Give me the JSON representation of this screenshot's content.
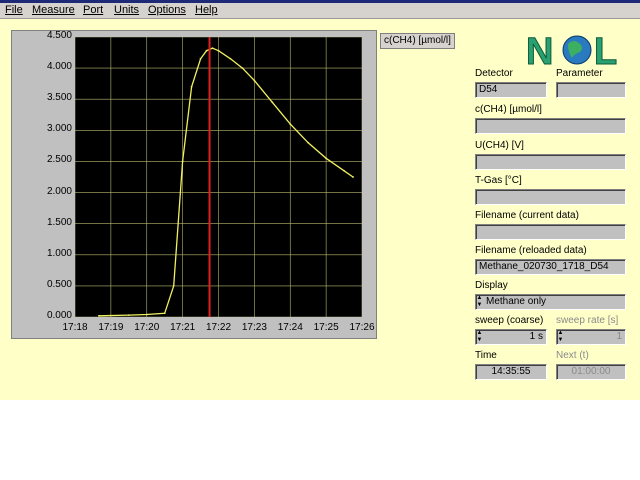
{
  "menu": {
    "items": [
      "File",
      "Measure",
      "Port",
      "Units",
      "Options",
      "Help"
    ]
  },
  "plot": {
    "label": "c(CH4) [µmol/l]",
    "y_ticks": [
      "4.500",
      "4.000",
      "3.500",
      "3.000",
      "2.500",
      "2.000",
      "1.500",
      "1.000",
      "0.500",
      "0.000"
    ],
    "x_ticks": [
      "17:18",
      "17:19",
      "17:20",
      "17:21",
      "17:22",
      "17:23",
      "17:24",
      "17:25",
      "17:26"
    ],
    "marker_time": "17:21:45",
    "colors": {
      "trace": "#f0f060",
      "marker": "#e02020",
      "grid": "#b8b870",
      "background": "#000000"
    }
  },
  "chart_data": {
    "type": "line",
    "title": "",
    "xlabel": "",
    "ylabel": "c(CH4) [µmol/l]",
    "xlim": [
      "17:18",
      "17:26"
    ],
    "ylim": [
      0,
      4.5
    ],
    "grid": true,
    "series": [
      {
        "x": [
          "17:18:40",
          "17:19:30",
          "17:20:00",
          "17:20:30",
          "17:20:45",
          "17:21:00",
          "17:21:15",
          "17:21:30",
          "17:21:40",
          "17:21:50",
          "17:22:00",
          "17:22:20",
          "17:22:40",
          "17:23:00",
          "17:23:30",
          "17:24:00",
          "17:24:30",
          "17:25:00",
          "17:25:30",
          "17:25:45"
        ],
        "y": [
          0.02,
          0.03,
          0.04,
          0.06,
          0.5,
          2.5,
          3.7,
          4.15,
          4.28,
          4.32,
          4.28,
          4.15,
          4.0,
          3.8,
          3.45,
          3.1,
          2.8,
          2.55,
          2.35,
          2.25
        ]
      }
    ]
  },
  "logo": {
    "text": "NOL"
  },
  "side": {
    "detector_label": "Detector",
    "detector_value": "D54",
    "parameter_label": "Parameter",
    "ch4_label": "c(CH4) [µmol/l]",
    "u_label": "U(CH4) [V]",
    "tgas_label": "T-Gas [°C]",
    "filename_current_label": "Filename (current data)",
    "filename_reloaded_label": "Filename (reloaded data)",
    "filename_reloaded_value": "Methane_020730_1718_D54",
    "display_label": "Display",
    "display_value": "Methane only",
    "sweep_coarse_label": "sweep (coarse)",
    "sweep_coarse_value": "1 s",
    "sweep_rate_label": "sweep rate [s]",
    "sweep_rate_value": "1",
    "time_label": "Time",
    "time_value": "14:35:55",
    "next_label": "Next (t)",
    "next_value": "01:00:00"
  }
}
